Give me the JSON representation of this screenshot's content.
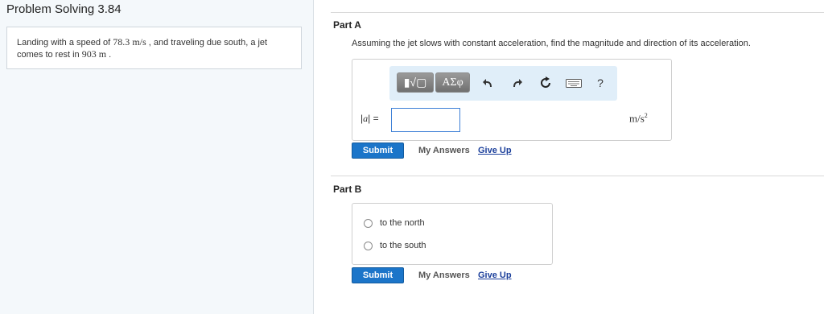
{
  "problem": {
    "title": "Problem Solving 3.84",
    "text_part1": "Landing with a speed of ",
    "speed": "78.3",
    "speed_unit": "m/s",
    "text_part2": " , and traveling due south, a jet comes to rest in ",
    "distance": "903",
    "distance_unit": "m",
    "text_part3": " ."
  },
  "partA": {
    "label": "Part A",
    "question": "Assuming the jet slows with constant acceleration, find the magnitude and direction of its acceleration.",
    "toolbar": {
      "templates_label": "▮√▢",
      "symbols_label": "ΑΣφ",
      "help_label": "?"
    },
    "variable": "a",
    "equals": "=",
    "input_value": "",
    "units_base": "m/s",
    "units_exp": "2",
    "submit_label": "Submit",
    "my_answers_label": "My Answers",
    "give_up_label": "Give Up"
  },
  "partB": {
    "label": "Part B",
    "choices": [
      "to the north",
      "to the south"
    ],
    "submit_label": "Submit",
    "my_answers_label": "My Answers",
    "give_up_label": "Give Up"
  },
  "colors": {
    "submit": "#1b75c9",
    "toolbar_bg": "#e0eef9",
    "link": "#1a3e9a"
  }
}
